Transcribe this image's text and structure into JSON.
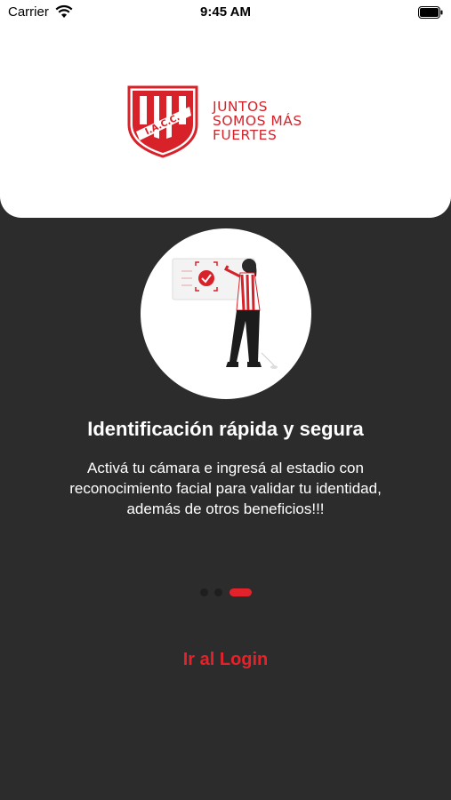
{
  "status_bar": {
    "carrier": "Carrier",
    "time": "9:45 AM"
  },
  "brand": {
    "crest_text": "I.A.C.C.",
    "slogan": [
      "JUNTOS",
      "SOMOS MÁS",
      "FUERTES"
    ],
    "colors": {
      "red": "#d8222a",
      "dark_bg": "#2c2c2c"
    }
  },
  "onboarding": {
    "title": "Identificación rápida y segura",
    "description": "Activá tu cámara e ingresá al estadio con reconocimiento facial para validar tu identidad, además de otros beneficios!!!",
    "page_count": 3,
    "active_page": 3
  },
  "actions": {
    "login_label": "Ir al Login"
  }
}
